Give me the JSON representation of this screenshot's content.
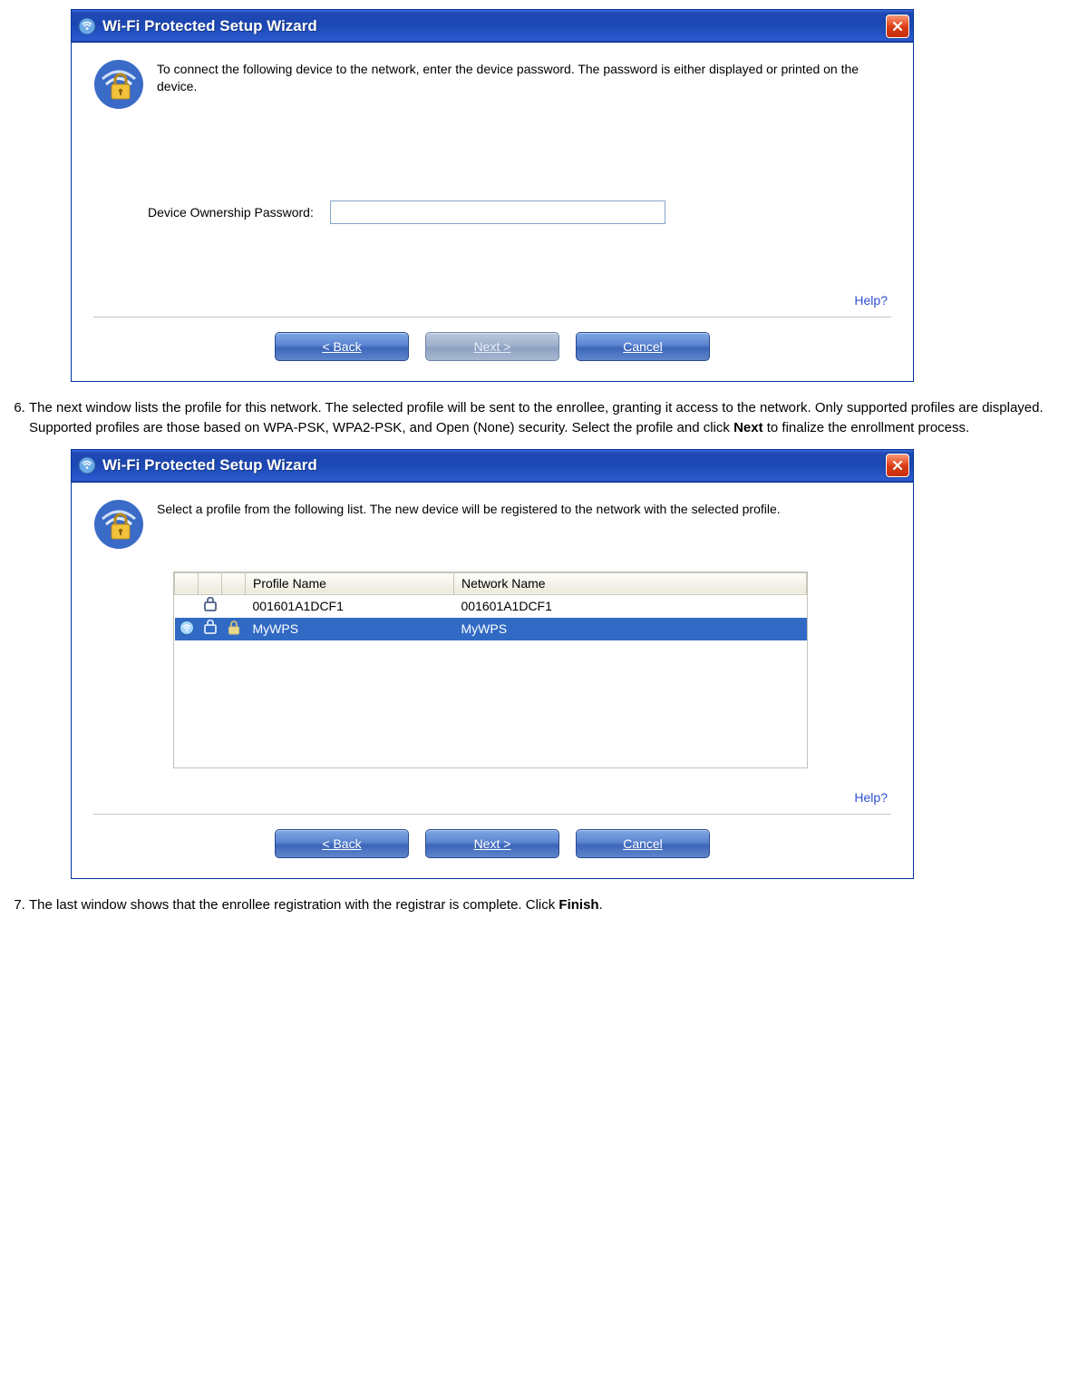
{
  "window1": {
    "title": "Wi-Fi Protected Setup Wizard",
    "intro": "To connect the following device to the network, enter the device password. The password is either displayed or printed on the device.",
    "password_label": "Device Ownership Password:",
    "password_value": "",
    "help": "Help?",
    "buttons": {
      "back": "< Back",
      "next": "Next >",
      "cancel": "Cancel"
    }
  },
  "step6": {
    "num": "6.",
    "text_a": "The next window lists the profile for this network. The selected profile will be sent to the enrollee, granting it access to the network. Only supported profiles are displayed. Supported profiles are those based on WPA-PSK, WPA2-PSK, and Open (None) security. Select the profile and click ",
    "bold": "Next",
    "text_b": " to finalize the enrollment process."
  },
  "window2": {
    "title": "Wi-Fi Protected Setup Wizard",
    "intro": "Select a profile from the following list. The new device will be registered to the network with the selected profile.",
    "headers": {
      "profile": "Profile Name",
      "network": "Network Name"
    },
    "rows": [
      {
        "profile": "001601A1DCF1",
        "network": "001601A1DCF1",
        "selected": false,
        "signal": false,
        "lock": false
      },
      {
        "profile": "MyWPS",
        "network": "MyWPS",
        "selected": true,
        "signal": true,
        "lock": true
      }
    ],
    "help": "Help?",
    "buttons": {
      "back": "< Back",
      "next": "Next >",
      "cancel": "Cancel"
    }
  },
  "step7": {
    "num": "7.",
    "text_a": "The last window shows that the enrollee registration with the registrar is complete. Click ",
    "bold": "Finish",
    "text_b": "."
  }
}
